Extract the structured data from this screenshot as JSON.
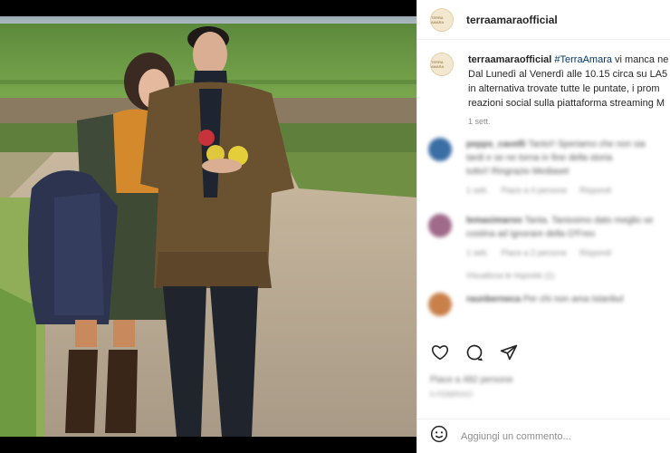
{
  "account": {
    "username": "terraamaraofficial",
    "avatar_text": "TERRA AMARA"
  },
  "caption": {
    "username": "terraamaraofficial",
    "hashtag": "#TerraAmara",
    "line1_rest": " vi manca ne",
    "line2": "Dal Lunedì al Venerdì alle 10.15 circa su LA5",
    "line3": "in alternativa trovate tutte le puntate, i prom",
    "line4": "reazioni social sulla piattaforma streaming M",
    "time": "1 sett."
  },
  "comments": [
    {
      "avatar_color": "#3b6ea5",
      "user": "pepps_cavelli",
      "text1": "Tanto!! Speriamo che non sia",
      "text2": "tardi e se ne torna in fine della storia",
      "text3": "tutto!! Ringrazio Mediaset",
      "time": "1 sett.",
      "likes": "Piace a 4 persone",
      "reply": "Rispondi"
    },
    {
      "avatar_color": "#a06a8a",
      "user": "lemaximaroo",
      "text1": "Tanta. Tanissimo dato meglio se",
      "text2": "costina ad ignorare della O'Freo",
      "text3": "",
      "time": "1 sett.",
      "likes": "Piace a 2 persone",
      "reply": "Rispondi",
      "replies_label": "Visualizza le risposte (1)"
    },
    {
      "avatar_color": "#c9804a",
      "user": "raunberneca",
      "text1": "Per chi non ama Istanbul",
      "text2": "",
      "text3": ""
    }
  ],
  "stats": {
    "likes": "Piace a 482 persone",
    "date": "6 FEBBRAIO"
  },
  "composer": {
    "placeholder": "Aggiungi un commento..."
  },
  "icons": [
    "heart-icon",
    "comment-icon",
    "share-icon",
    "emoji-icon"
  ],
  "colors": {
    "link": "#00376b",
    "text": "#262626",
    "muted": "#8e8e8e"
  }
}
